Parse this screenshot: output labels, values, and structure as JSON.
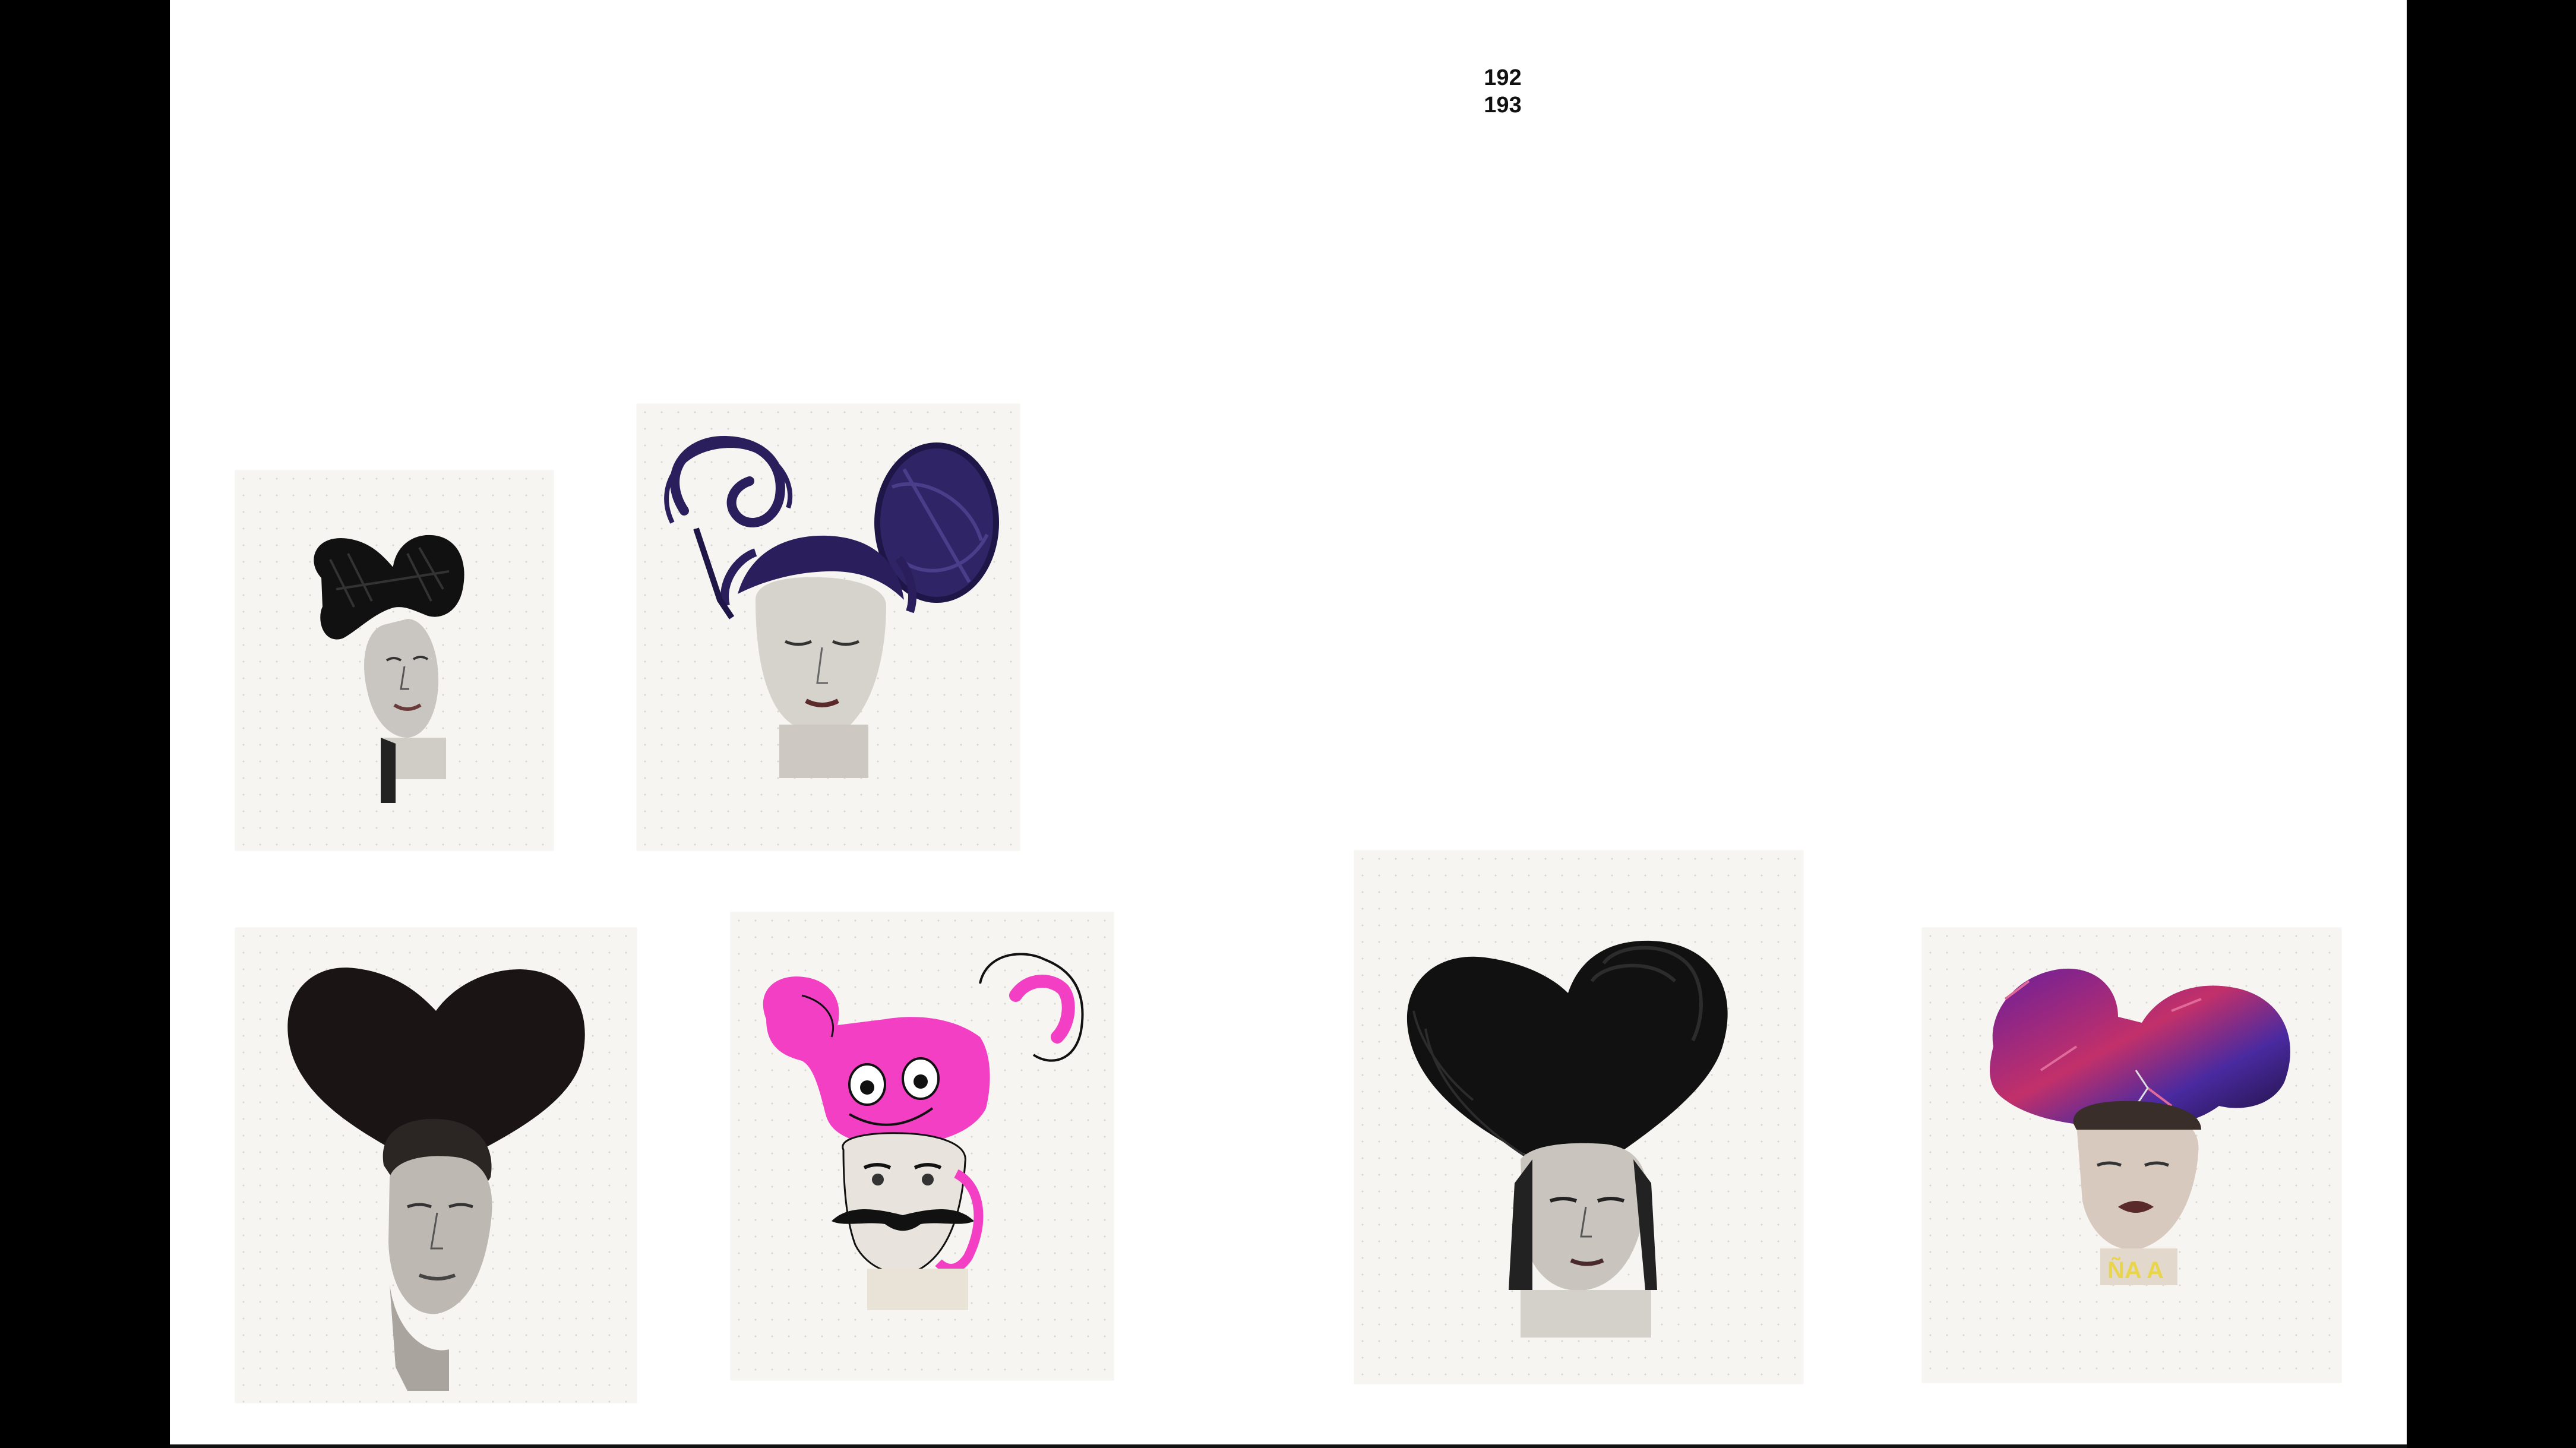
{
  "page_numbers": {
    "left": "192",
    "right": "193"
  },
  "collages": [
    {
      "name": "collage-woman-black-bow"
    },
    {
      "name": "collage-woman-purple-ears"
    },
    {
      "name": "collage-man-black-heart"
    },
    {
      "name": "collage-man-pink-mask"
    },
    {
      "name": "collage-woman-black-ears"
    },
    {
      "name": "collage-boy-cosmic-ears",
      "caption": "ÑA A"
    }
  ],
  "colors": {
    "page": "#ffffff",
    "frame": "#000000",
    "ink_black": "#111111",
    "ink_purple": "#2a1f5c",
    "ink_pink": "#f23fc4",
    "cosmic_purple": "#6a1f9a",
    "cosmic_red": "#c2306a",
    "caption_yellow": "#e9d54a"
  },
  "icons": [
    "book-spread",
    "collage-image"
  ]
}
